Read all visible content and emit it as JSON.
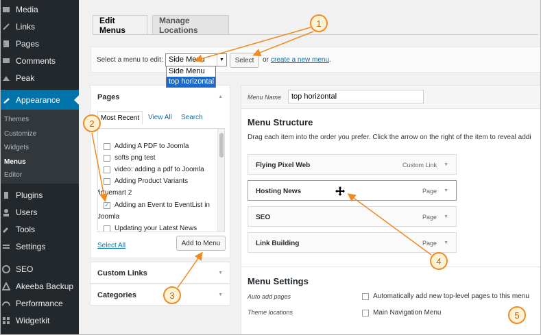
{
  "sidebar": {
    "items": [
      {
        "label": "Media",
        "icon": "media-icon"
      },
      {
        "label": "Links",
        "icon": "links-icon"
      },
      {
        "label": "Pages",
        "icon": "pages-icon"
      },
      {
        "label": "Comments",
        "icon": "comments-icon"
      },
      {
        "label": "Peak",
        "icon": "peak-icon"
      },
      {
        "label": "Appearance",
        "icon": "appearance-icon"
      },
      {
        "label": "Plugins",
        "icon": "plugins-icon"
      },
      {
        "label": "Users",
        "icon": "users-icon"
      },
      {
        "label": "Tools",
        "icon": "tools-icon"
      },
      {
        "label": "Settings",
        "icon": "settings-icon"
      },
      {
        "label": "SEO",
        "icon": "seo-icon"
      },
      {
        "label": "Akeeba Backup",
        "icon": "akeeba-icon"
      },
      {
        "label": "Performance",
        "icon": "performance-icon"
      },
      {
        "label": "Widgetkit",
        "icon": "widgetkit-icon"
      }
    ],
    "submenu": [
      "Themes",
      "Customize",
      "Widgets",
      "Menus",
      "Editor"
    ]
  },
  "tabs": {
    "edit": "Edit Menus",
    "manage": "Manage Locations"
  },
  "manage_bar": {
    "label": "Select a menu to edit:",
    "selected": "Side Menu",
    "options": [
      "Side Menu",
      "top horizontal"
    ],
    "select_button": "Select",
    "or_text": "or",
    "create_link": "create a new menu",
    "period": "."
  },
  "pages_panel": {
    "title": "Pages",
    "tabs": [
      "Most Recent",
      "View All",
      "Search"
    ],
    "items": [
      {
        "label": "Adding A PDF to Joomla",
        "checked": false
      },
      {
        "label": "softs png test",
        "checked": false
      },
      {
        "label": "video: adding a pdf to Joomla",
        "checked": false
      },
      {
        "label": "Adding Product Variants",
        "checked": false
      },
      {
        "label": "Virtuemart 2",
        "checked": false,
        "continuation": true
      },
      {
        "label": "Adding an Event to EventList in",
        "checked": true
      },
      {
        "label": "Joomla",
        "checked": false,
        "continuation": true
      },
      {
        "label": "Updating your Latest News",
        "checked": false
      }
    ],
    "select_all": "Select All",
    "add_button": "Add to Menu",
    "check_mark": "✓"
  },
  "custom_links": {
    "title": "Custom Links"
  },
  "categories": {
    "title": "Categories"
  },
  "menu_edit": {
    "name_label": "Menu Name",
    "name_value": "top horizontal",
    "structure_title": "Menu Structure",
    "structure_desc": "Drag each item into the order you prefer. Click the arrow on the right of the item to reveal addi",
    "items": [
      {
        "title": "Flying Pixel Web",
        "type": "Custom Link"
      },
      {
        "title": "Hosting News",
        "type": "Page"
      },
      {
        "title": "SEO",
        "type": "Page"
      },
      {
        "title": "Link Building",
        "type": "Page"
      }
    ],
    "settings_title": "Menu Settings",
    "auto_add_label": "Auto add pages",
    "auto_add_option": "Automatically add new top-level pages to this menu",
    "theme_locations_label": "Theme locations",
    "theme_location_option": "Main Navigation Menu"
  },
  "callouts": [
    "1",
    "2",
    "3",
    "4",
    "5"
  ],
  "colors": {
    "sidebar": "#23282d",
    "active": "#0073aa",
    "callout": "#f08a24"
  }
}
